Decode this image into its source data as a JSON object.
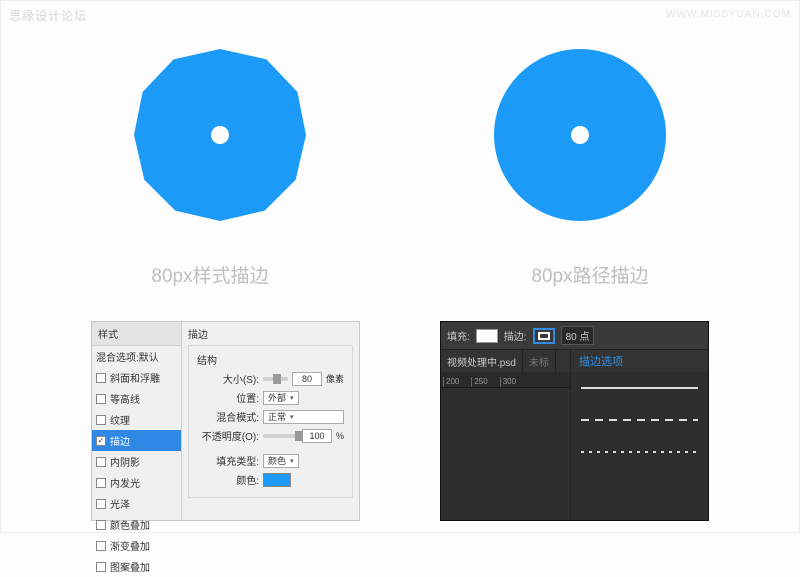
{
  "watermark_left": "思缘设计论坛",
  "watermark_right": "WWW.MISSYUAN.COM",
  "caption_left": "80px样式描边",
  "caption_right": "80px路径描边",
  "left_panel": {
    "col_header": "样式",
    "col_subheader": "混合选项:默认",
    "items": [
      {
        "label": "斜面和浮雕",
        "checked": false
      },
      {
        "label": "等高线",
        "checked": false
      },
      {
        "label": "纹理",
        "checked": false
      },
      {
        "label": "描边",
        "checked": true,
        "selected": true
      },
      {
        "label": "内阴影",
        "checked": false
      },
      {
        "label": "内发光",
        "checked": false
      },
      {
        "label": "光泽",
        "checked": false
      },
      {
        "label": "颜色叠加",
        "checked": false
      },
      {
        "label": "渐变叠加",
        "checked": false
      },
      {
        "label": "图案叠加",
        "checked": false
      }
    ],
    "main_title": "描边",
    "group_title": "结构",
    "size_label": "大小(S):",
    "size_value": "80",
    "size_unit": "像素",
    "position_label": "位置:",
    "position_value": "外部",
    "blend_label": "混合模式:",
    "blend_value": "正常",
    "opacity_label": "不透明度(O):",
    "opacity_value": "100",
    "opacity_unit": "%",
    "filltype_label": "填充类型:",
    "filltype_value": "颜色",
    "color_label": "颜色:",
    "color_hex": "#1b9af7"
  },
  "right_panel": {
    "fill_label": "填充:",
    "stroke_label": "描边:",
    "stroke_size": "80 点",
    "tab_active": "视频处理中.psd",
    "tab_inactive": "未标",
    "section_title": "描边选项",
    "ruler_ticks": [
      "200",
      "250",
      "300"
    ]
  }
}
